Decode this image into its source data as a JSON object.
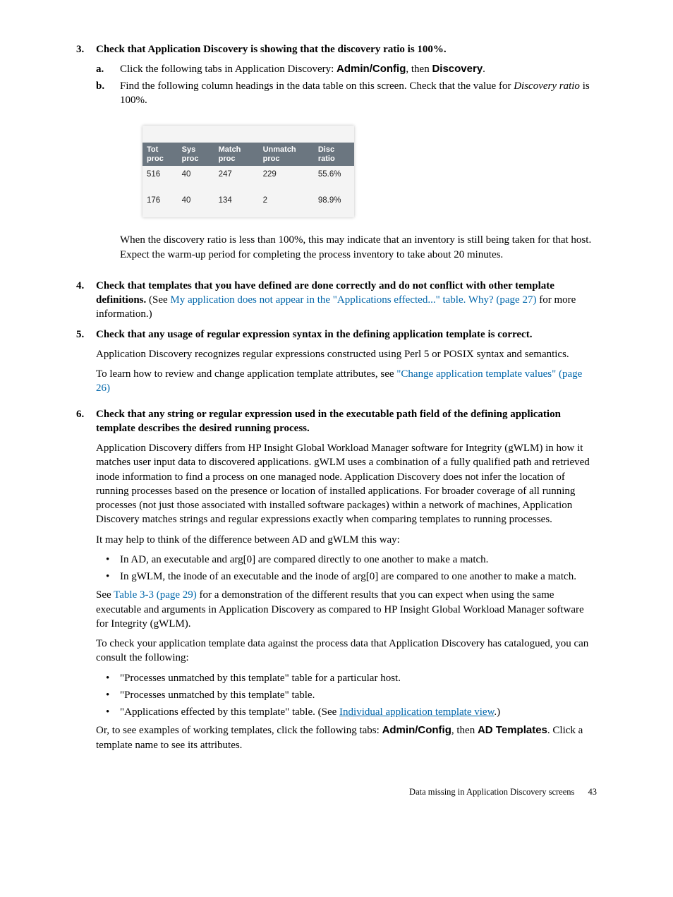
{
  "items": [
    {
      "num": "3.",
      "title": "Check that Application Discovery is showing that the discovery ratio is 100%.",
      "sub": [
        {
          "num": "a.",
          "pre": "Click the following tabs in Application Discovery: ",
          "b1": "Admin/Config",
          "mid": ", then ",
          "b2": "Discovery",
          "post": "."
        },
        {
          "num": "b.",
          "text": "Find the following column headings in the data table on this screen. Check that the value for ",
          "it": "Discovery ratio",
          "after": " is 100%."
        }
      ],
      "table": {
        "headers": [
          "Tot proc",
          "Sys proc",
          "Match proc",
          "Unmatch proc",
          "Disc ratio"
        ],
        "rows": [
          [
            "516",
            "40",
            "247",
            "229",
            "55.6%"
          ],
          [
            "176",
            "40",
            "134",
            "2",
            "98.9%"
          ]
        ]
      },
      "tail": "When the discovery ratio is less than 100%, this may indicate that an inventory is still being taken for that host. Expect the warm-up period for completing the process inventory to take about 20 minutes."
    },
    {
      "num": "4.",
      "strong": "Check that templates that you have defined are done correctly and do not conflict with other template definitions.",
      "after1": " (See ",
      "link": "My application does not appear in the \"Applications effected...\" table. Why? (page 27)",
      "after2": " for more information.)"
    },
    {
      "num": "5.",
      "strong": "Check that any usage of regular expression syntax in the defining application template is correct.",
      "paras": [
        "Application Discovery recognizes regular expressions constructed using Perl 5 or POSIX syntax and semantics."
      ],
      "link_lead": "To learn how to review and change application template attributes, see ",
      "link": "\"Change application template values\" (page 26)"
    },
    {
      "num": "6.",
      "strong": "Check that any string or regular expression used in the executable path field of the defining application template describes the desired running process.",
      "paras": [
        "Application Discovery differs from HP Insight Global Workload Manager software for Integrity (gWLM) in how it matches user input data to discovered applications. gWLM uses a combination of a fully qualified path and retrieved inode information to find a process on one managed node. Application Discovery does not infer the location of running processes based on the presence or location of installed applications. For broader coverage of all running processes (not just those associated with installed software packages) within a network of machines, Application Discovery matches strings and regular expressions exactly when comparing templates to running processes.",
        "It may help to think of the difference between AD and gWLM this way:"
      ],
      "bullets1": [
        "In AD, an executable and arg[0] are compared directly to one another to make a match.",
        "In gWLM, the inode of an executable and the inode of arg[0] are compared to one another to make a match."
      ],
      "see_lead": "See ",
      "see_link": "Table 3-3 (page 29)",
      "see_tail": " for a demonstration of the different results that you can expect when using the same executable and arguments in Application Discovery as compared to HP Insight Global Workload Manager software for Integrity (gWLM).",
      "check_para": "To check your application template data against the process data that Application Discovery has catalogued, you can consult the following:",
      "bullets2": [
        {
          "text": "\"Processes unmatched by this template\" table for a particular host."
        },
        {
          "text": "\"Processes unmatched by this template\" table."
        },
        {
          "text_pre": "\"Applications effected by this template\" table. (See ",
          "ulink": "Individual application template view",
          "text_post": ".)"
        }
      ],
      "or_lead": "Or, to see examples of working templates, click the following tabs: ",
      "or_b1": "Admin/Config",
      "or_mid": ", then ",
      "or_b2": "AD Templates",
      "or_tail": ". Click a template name to see its attributes."
    }
  ],
  "footer": {
    "title": "Data missing in Application Discovery screens",
    "page": "43"
  }
}
